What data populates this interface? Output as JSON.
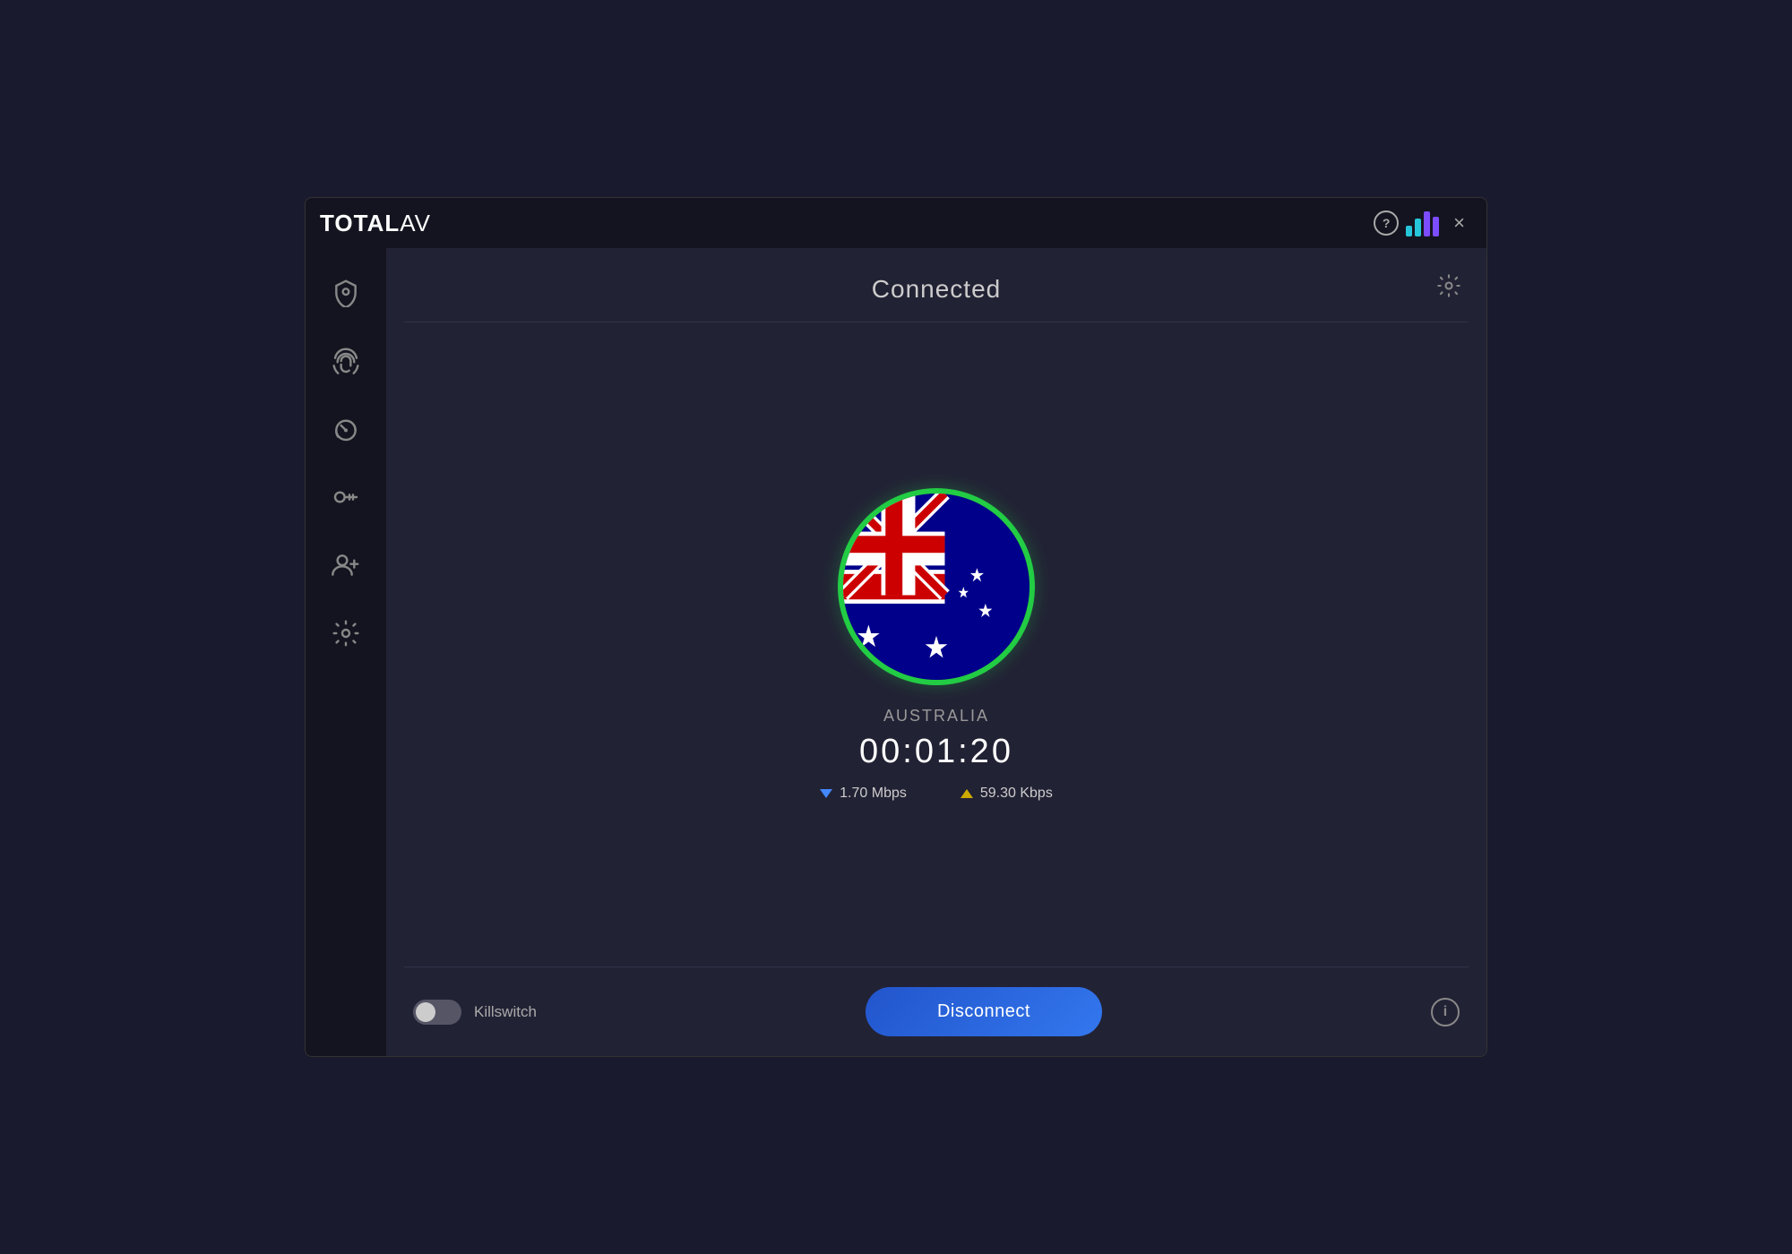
{
  "app": {
    "title_total": "TOTAL",
    "title_av": "AV"
  },
  "titlebar": {
    "help_label": "?",
    "close_label": "×"
  },
  "sidebar": {
    "items": [
      {
        "id": "shield",
        "label": "Shield"
      },
      {
        "id": "fingerprint",
        "label": "Fingerprint"
      },
      {
        "id": "speedometer",
        "label": "Speedometer"
      },
      {
        "id": "key",
        "label": "Key"
      },
      {
        "id": "add-user",
        "label": "Add User"
      },
      {
        "id": "settings",
        "label": "Settings"
      }
    ]
  },
  "vpn": {
    "status": "Connected",
    "country": "AUSTRALIA",
    "timer": "00:01:20",
    "download_speed": "1.70 Mbps",
    "upload_speed": "59.30 Kbps",
    "killswitch_label": "Killswitch",
    "disconnect_label": "Disconnect",
    "info_label": "i",
    "settings_label": "⚙"
  }
}
